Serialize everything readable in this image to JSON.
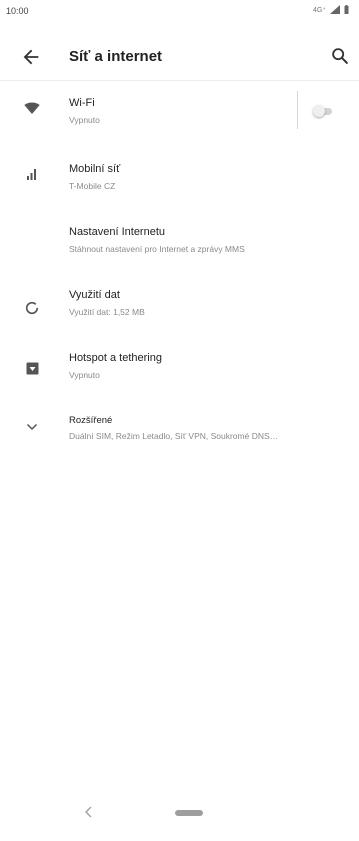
{
  "status_bar": {
    "time": "10:00",
    "network_type": "4G⁺",
    "icons": [
      "signal-icon",
      "battery-icon"
    ]
  },
  "app_bar": {
    "title": "Síť a internet",
    "back_icon": "arrow-left-icon",
    "search_icon": "search-icon"
  },
  "settings": [
    {
      "key": "wifi",
      "icon": "wifi-icon",
      "title": "Wi-Fi",
      "subtitle": "Vypnuto",
      "toggle_on": false
    },
    {
      "key": "mobile",
      "icon": "cell-signal-icon",
      "title": "Mobilní síť",
      "subtitle": "T-Mobile CZ"
    },
    {
      "key": "internet-settings",
      "icon": "",
      "title": "Nastavení Internetu",
      "subtitle": "Stáhnout nastavení pro Internet a zprávy MMS"
    },
    {
      "key": "data-usage",
      "icon": "data-usage-icon",
      "title": "Využití dat",
      "subtitle": "Využití dat: 1,52 MB"
    },
    {
      "key": "hotspot",
      "icon": "hotspot-icon",
      "title": "Hotspot a tethering",
      "subtitle": "Vypnuto"
    },
    {
      "key": "advanced",
      "icon": "chevron-down-icon",
      "title": "Rozšířené",
      "subtitle": "Duální SIM, Režim Letadlo, Síť VPN, Soukromé DNS…"
    }
  ],
  "nav_bar": {
    "back_icon": "nav-back-icon",
    "home_icon": "home-pill-icon"
  },
  "colors": {
    "text_primary": "#222222",
    "text_secondary": "#8a8a8a",
    "icon": "#555555",
    "toggle_off_track": "#d3d3d3"
  }
}
